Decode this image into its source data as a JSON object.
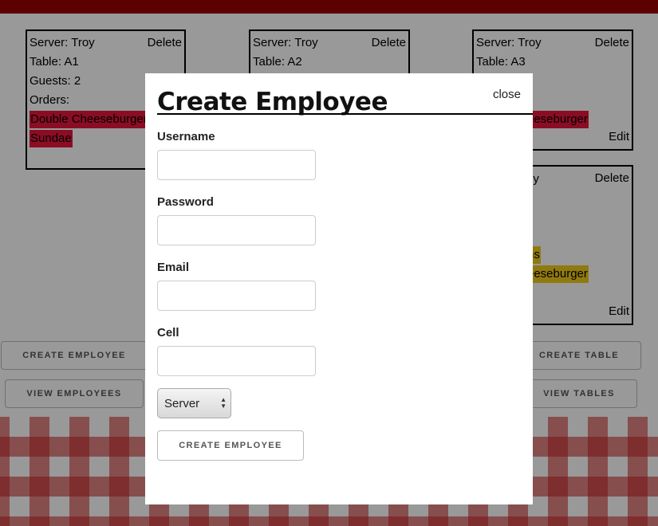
{
  "colors": {
    "topbar": "#990000",
    "order_red": "#e8173c",
    "order_yellow": "#f0cc19"
  },
  "cards": [
    {
      "server": "Server: Troy",
      "table": "Table: A1",
      "guests": "Guests: 2",
      "orders_label": "Orders:",
      "orders": [
        "Double Cheeseburger",
        "Sundae"
      ],
      "delete": "Delete"
    },
    {
      "server": "Server: Troy",
      "table": "Table: A2",
      "delete": "Delete"
    },
    {
      "server": "Server: Troy",
      "table": "Table: A3",
      "orders": [
        "eeseburger"
      ],
      "delete": "Delete",
      "edit": "Edit"
    },
    {
      "server": "oy",
      "orders": [
        "ns",
        "eeseburger"
      ],
      "delete": "Delete",
      "edit": "Edit"
    }
  ],
  "buttons": {
    "create_employee": "CREATE EMPLOYEE",
    "view_employees": "VIEW EMPLOYEES",
    "create_table": "CREATE TABLE",
    "view_tables": "VIEW TABLES"
  },
  "modal": {
    "title": "Create Employee",
    "close": "close",
    "fields": {
      "username": "Username",
      "password": "Password",
      "email": "Email",
      "cell": "Cell"
    },
    "role_select": {
      "selected": "Server",
      "icon": "updown-arrows-icon"
    },
    "submit": "CREATE EMPLOYEE"
  }
}
